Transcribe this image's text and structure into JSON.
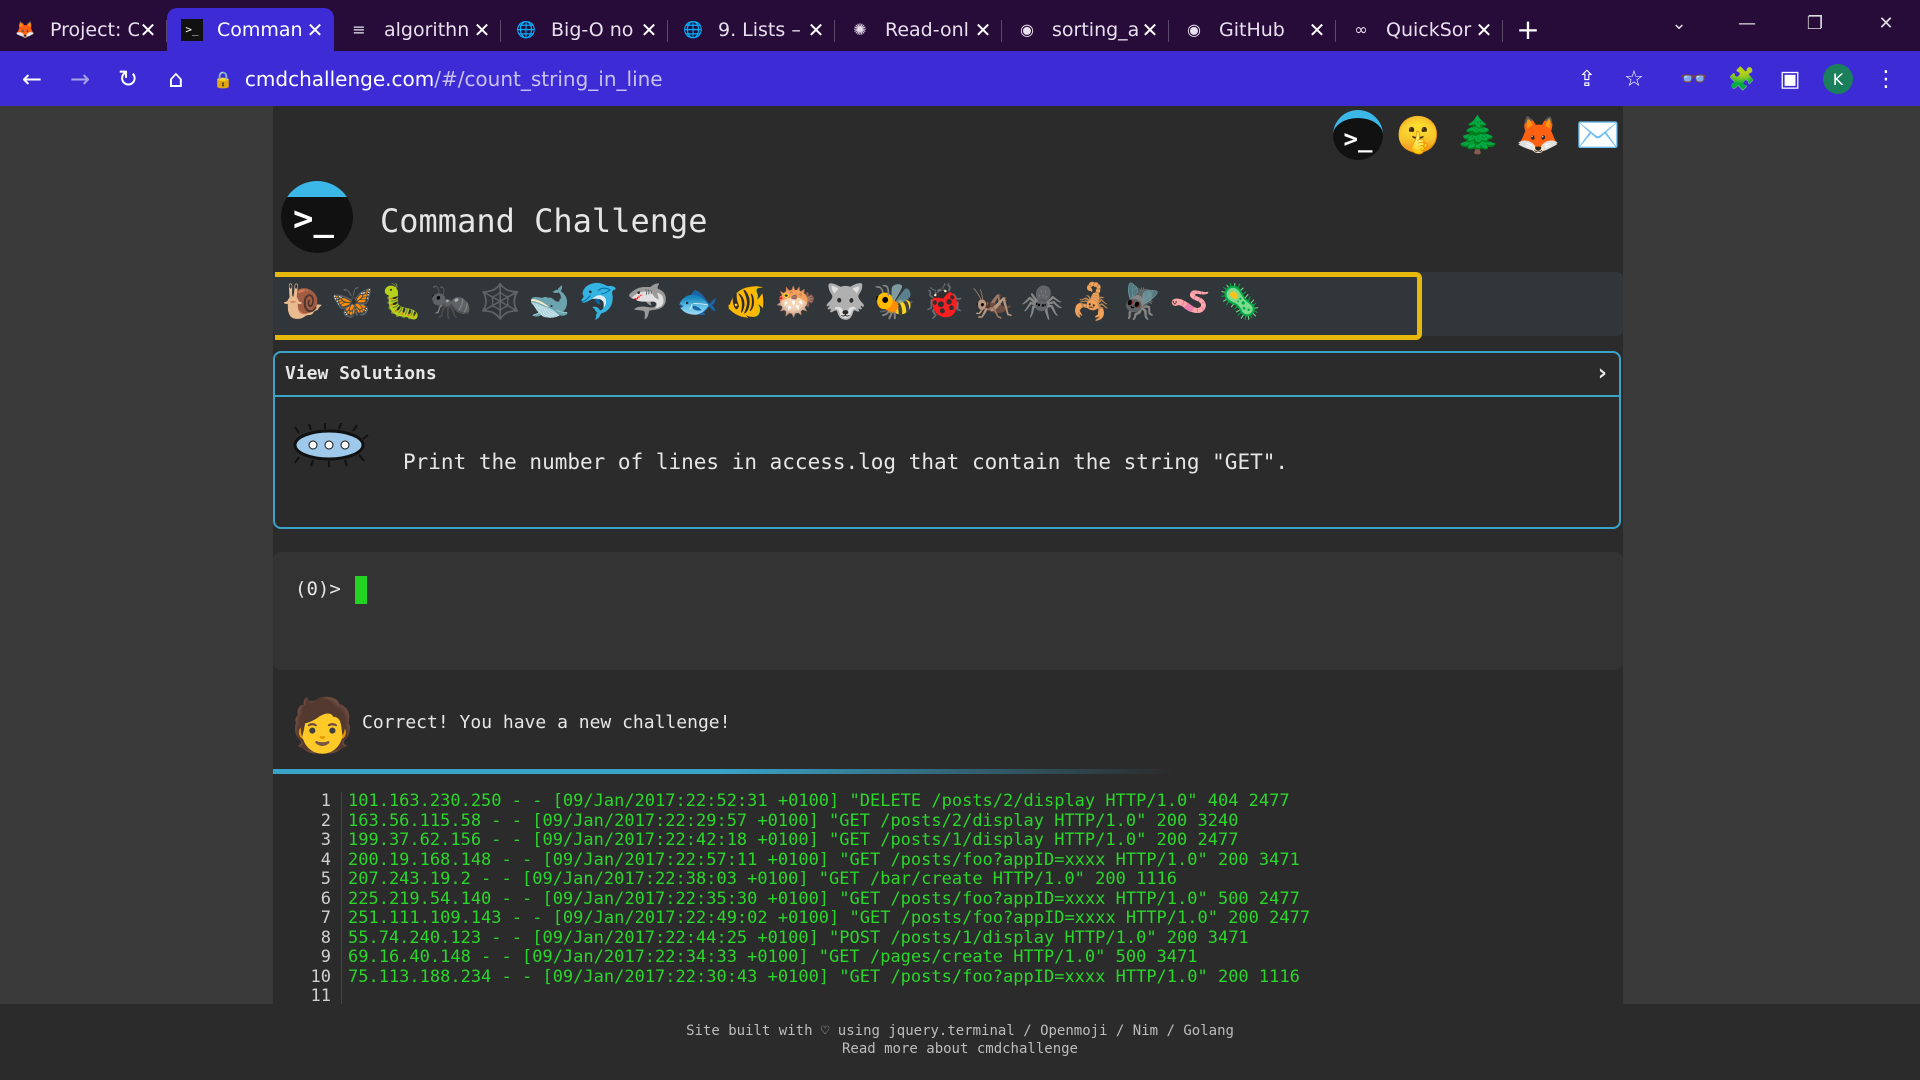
{
  "browser": {
    "tabs": [
      {
        "title": "Project: C",
        "icon": "gitlab-icon"
      },
      {
        "title": "Comman",
        "icon": "terminal-icon",
        "active": true
      },
      {
        "title": "algorithn",
        "icon": "stackoverflow-icon"
      },
      {
        "title": "Big-O no",
        "icon": "globe-icon"
      },
      {
        "title": "9. Lists –",
        "icon": "globe-icon"
      },
      {
        "title": "Read-onl",
        "icon": "openai-icon"
      },
      {
        "title": "sorting_a",
        "icon": "github-icon"
      },
      {
        "title": "GitHub",
        "icon": "github-icon"
      },
      {
        "title": "QuickSor",
        "icon": "gfg-icon"
      }
    ],
    "url_host": "cmdchallenge.com",
    "url_path": "/#/count_string_in_line",
    "profile_initial": "K"
  },
  "site": {
    "title": "Command Challenge",
    "view_solutions": "View Solutions",
    "task": "Print the number of lines in access.log that contain the string \"GET\".",
    "prompt": "(0)>",
    "result_message": "Correct! You have a new challenge!",
    "footer_line1": "Site built with ♡ using jquery.terminal / Openmoji / Nim / Golang",
    "footer_line2": "Read more about cmdchallenge"
  },
  "log_lines": [
    "101.163.230.250 - - [09/Jan/2017:22:52:31 +0100] \"DELETE /posts/2/display HTTP/1.0\" 404 2477",
    "163.56.115.58 - - [09/Jan/2017:22:29:57 +0100] \"GET /posts/2/display HTTP/1.0\" 200 3240",
    "199.37.62.156 - - [09/Jan/2017:22:42:18 +0100] \"GET /posts/1/display HTTP/1.0\" 200 2477",
    "200.19.168.148 - - [09/Jan/2017:22:57:11 +0100] \"GET /posts/foo?appID=xxxx HTTP/1.0\" 200 3471",
    "207.243.19.2 - - [09/Jan/2017:22:38:03 +0100] \"GET /bar/create HTTP/1.0\" 200 1116",
    "225.219.54.140 - - [09/Jan/2017:22:35:30 +0100] \"GET /posts/foo?appID=xxxx HTTP/1.0\" 500 2477",
    "251.111.109.143 - - [09/Jan/2017:22:49:02 +0100] \"GET /posts/foo?appID=xxxx HTTP/1.0\" 200 2477",
    "55.74.240.123 - - [09/Jan/2017:22:44:25 +0100] \"POST /posts/1/display HTTP/1.0\" 200 3471",
    "69.16.40.148 - - [09/Jan/2017:22:34:33 +0100] \"GET /pages/create HTTP/1.0\" 500 3471",
    "75.113.188.234 - - [09/Jan/2017:22:30:43 +0100] \"GET /posts/foo?appID=xxxx HTTP/1.0\" 200 1116",
    ""
  ],
  "animals": [
    "🐌",
    "🦋",
    "🐛",
    "🐜",
    "🕸️",
    "🐋",
    "🐬",
    "🦈",
    "🐟",
    "🐠",
    "🐡",
    "🐺",
    "🐝",
    "🐞",
    "🦗",
    "🕷️",
    "🦂",
    "🪰",
    "🪱",
    "🦠"
  ],
  "colors": {
    "accent": "#3d2bd6",
    "highlight": "#e5b80b",
    "border": "#3aa3c8",
    "log_text": "#2bd62b"
  }
}
